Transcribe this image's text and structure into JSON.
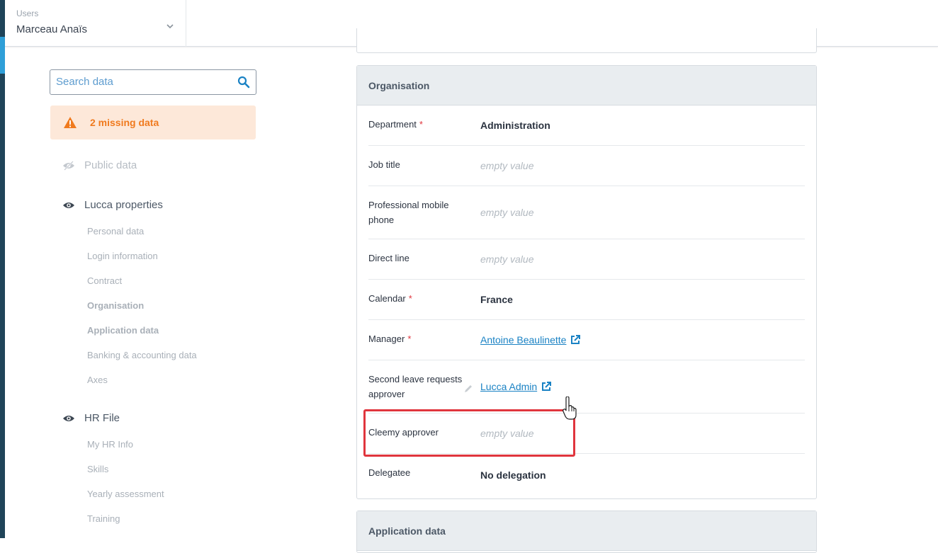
{
  "topbar": {
    "users_label": "Users",
    "selected_user": "Marceau Anaïs"
  },
  "sidebar": {
    "search_placeholder": "Search data",
    "missing_alert": "2 missing data",
    "groups": [
      {
        "label": "Public data",
        "items": []
      },
      {
        "label": "Lucca properties",
        "items": [
          "Personal data",
          "Login information",
          "Contract",
          "Organisation",
          "Application data",
          "Banking & accounting data",
          "Axes"
        ]
      },
      {
        "label": "HR File",
        "items": [
          "My HR Info",
          "Skills",
          "Yearly assessment",
          "Training"
        ]
      }
    ]
  },
  "organisation": {
    "title": "Organisation",
    "rows": [
      {
        "label": "Department",
        "required": "*",
        "value": "Administration"
      },
      {
        "label": "Job title",
        "value": "empty value"
      },
      {
        "label": "Professional mobile phone",
        "value": "empty value"
      },
      {
        "label": "Direct line",
        "value": "empty value"
      },
      {
        "label": "Calendar",
        "required": "*",
        "value": "France"
      },
      {
        "label": "Manager",
        "required": "*",
        "value": "Antoine Beaulinette"
      },
      {
        "label": "Second leave requests approver",
        "value": "Lucca Admin"
      },
      {
        "label": "Cleemy approver",
        "value": "empty value"
      },
      {
        "label": "Delegatee",
        "value": "No delegation"
      }
    ]
  },
  "application_data": {
    "title": "Application data"
  },
  "colors": {
    "accent": "#2f9fd8",
    "warning": "#f07a1e",
    "required": "#e0353d",
    "link": "#1a82c4",
    "highlight": "#e0353d"
  }
}
